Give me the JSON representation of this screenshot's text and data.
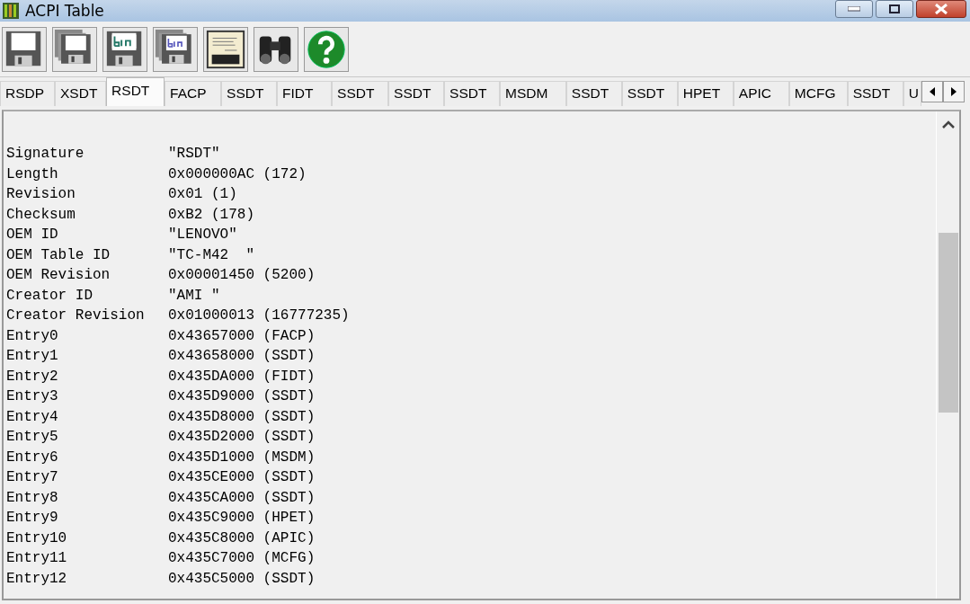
{
  "window": {
    "title": "ACPI Table"
  },
  "toolbar": [
    {
      "kind": "save"
    },
    {
      "kind": "save-all"
    },
    {
      "kind": "save-bin"
    },
    {
      "kind": "save-all-bin"
    },
    {
      "kind": "asl"
    },
    {
      "kind": "find"
    },
    {
      "kind": "help"
    }
  ],
  "tabs": [
    {
      "label": "RSDP",
      "selected": false
    },
    {
      "label": "XSDT",
      "selected": false
    },
    {
      "label": "RSDT",
      "selected": true
    },
    {
      "label": "FACP",
      "selected": false
    },
    {
      "label": "SSDT",
      "selected": false
    },
    {
      "label": "FIDT",
      "selected": false
    },
    {
      "label": "SSDT",
      "selected": false
    },
    {
      "label": "SSDT",
      "selected": false
    },
    {
      "label": "SSDT",
      "selected": false
    },
    {
      "label": "MSDM",
      "selected": false
    },
    {
      "label": "SSDT",
      "selected": false
    },
    {
      "label": "SSDT",
      "selected": false
    },
    {
      "label": "HPET",
      "selected": false
    },
    {
      "label": "APIC",
      "selected": false
    },
    {
      "label": "MCFG",
      "selected": false
    },
    {
      "label": "SSDT",
      "selected": false
    },
    {
      "label": "U",
      "selected": false
    }
  ],
  "fields": [
    {
      "name": "Signature",
      "value": "\"RSDT\""
    },
    {
      "name": "Length",
      "value": "0x000000AC (172)"
    },
    {
      "name": "Revision",
      "value": "0x01 (1)"
    },
    {
      "name": "Checksum",
      "value": "0xB2 (178)"
    },
    {
      "name": "OEM ID",
      "value": "\"LENOVO\""
    },
    {
      "name": "OEM Table ID",
      "value": "\"TC-M42  \""
    },
    {
      "name": "OEM Revision",
      "value": "0x00001450 (5200)"
    },
    {
      "name": "Creator ID",
      "value": "\"AMI \""
    },
    {
      "name": "Creator Revision",
      "value": "0x01000013 (16777235)"
    },
    {
      "name": "Entry0",
      "value": "0x43657000 (FACP)"
    },
    {
      "name": "Entry1",
      "value": "0x43658000 (SSDT)"
    },
    {
      "name": "Entry2",
      "value": "0x435DA000 (FIDT)"
    },
    {
      "name": "Entry3",
      "value": "0x435D9000 (SSDT)"
    },
    {
      "name": "Entry4",
      "value": "0x435D8000 (SSDT)"
    },
    {
      "name": "Entry5",
      "value": "0x435D2000 (SSDT)"
    },
    {
      "name": "Entry6",
      "value": "0x435D1000 (MSDM)"
    },
    {
      "name": "Entry7",
      "value": "0x435CE000 (SSDT)"
    },
    {
      "name": "Entry8",
      "value": "0x435CA000 (SSDT)"
    },
    {
      "name": "Entry9",
      "value": "0x435C9000 (HPET)"
    },
    {
      "name": "Entry10",
      "value": "0x435C8000 (APIC)"
    },
    {
      "name": "Entry11",
      "value": "0x435C7000 (MCFG)"
    },
    {
      "name": "Entry12",
      "value": "0x435C5000 (SSDT)"
    }
  ]
}
